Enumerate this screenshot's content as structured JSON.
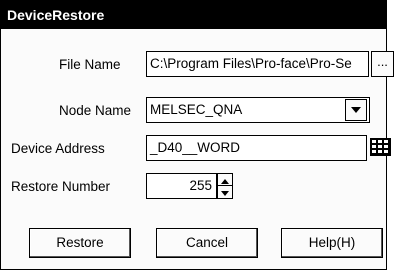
{
  "dialog": {
    "title": "DeviceRestore"
  },
  "fields": {
    "file_name_label": "File Name",
    "file_name_value": "C:\\Program Files\\Pro-face\\Pro-Se",
    "browse_label": "...",
    "node_name_label": "Node Name",
    "node_name_value": "MELSEC_QNA",
    "device_address_label": "Device Address",
    "device_address_value": "_D40__WORD",
    "restore_number_label": "Restore Number",
    "restore_number_value": "255"
  },
  "buttons": {
    "restore": "Restore",
    "cancel": "Cancel",
    "help": "Help(H)"
  },
  "icons": {
    "dropdown": "chevron-down-icon",
    "device_picker": "keypad-icon",
    "spin_up": "spin-up-icon",
    "spin_down": "spin-down-icon"
  }
}
